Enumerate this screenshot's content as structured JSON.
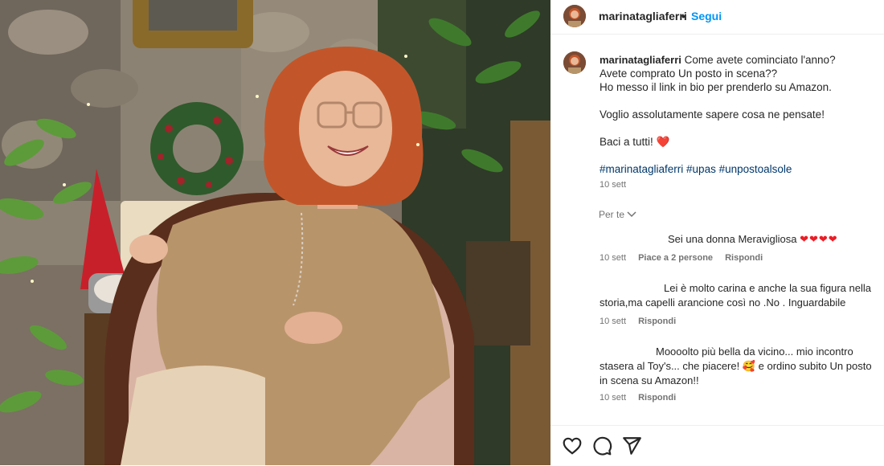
{
  "header": {
    "username": "marinatagliaferri",
    "separator": "•",
    "follow_label": "Segui"
  },
  "post": {
    "username": "marinatagliaferri",
    "caption_lines": [
      "Come avete cominciato l'anno?",
      "Avete comprato Un posto in scena??",
      "Ho messo il link in bio per prenderlo su Amazon.",
      "Voglio assolutamente sapere cosa ne pensate!",
      "Baci a tutti!"
    ],
    "hashtags": "#marinatagliaferri #upas #unpostoalsole",
    "time": "10 sett",
    "translate_label": "Per te"
  },
  "comments": [
    {
      "text": "Sei una donna Meravigliosa",
      "hearts": "❤❤❤❤",
      "time": "10 sett",
      "likes": "Piace a 2 persone",
      "reply": "Rispondi"
    },
    {
      "text": "Lei è molto carina e anche la sua figura nella storia,ma capelli arancione così no .No . Inguardabile",
      "time": "10 sett",
      "reply": "Rispondi"
    },
    {
      "text_a": "Moooolto più bella da vicino... mio incontro stasera al Toy's... che piacere!",
      "emoji": "🥰",
      "text_b": "e ordino subito Un posto in scena su Amazon!!",
      "time": "10 sett",
      "reply": "Rispondi"
    }
  ],
  "icons": {
    "like": "heart-icon",
    "comment": "comment-icon",
    "share": "share-icon"
  },
  "colors": {
    "link_blue": "#0095f6",
    "hashtag": "#00376b",
    "heart_red": "#ed1c24",
    "muted": "#737373"
  }
}
